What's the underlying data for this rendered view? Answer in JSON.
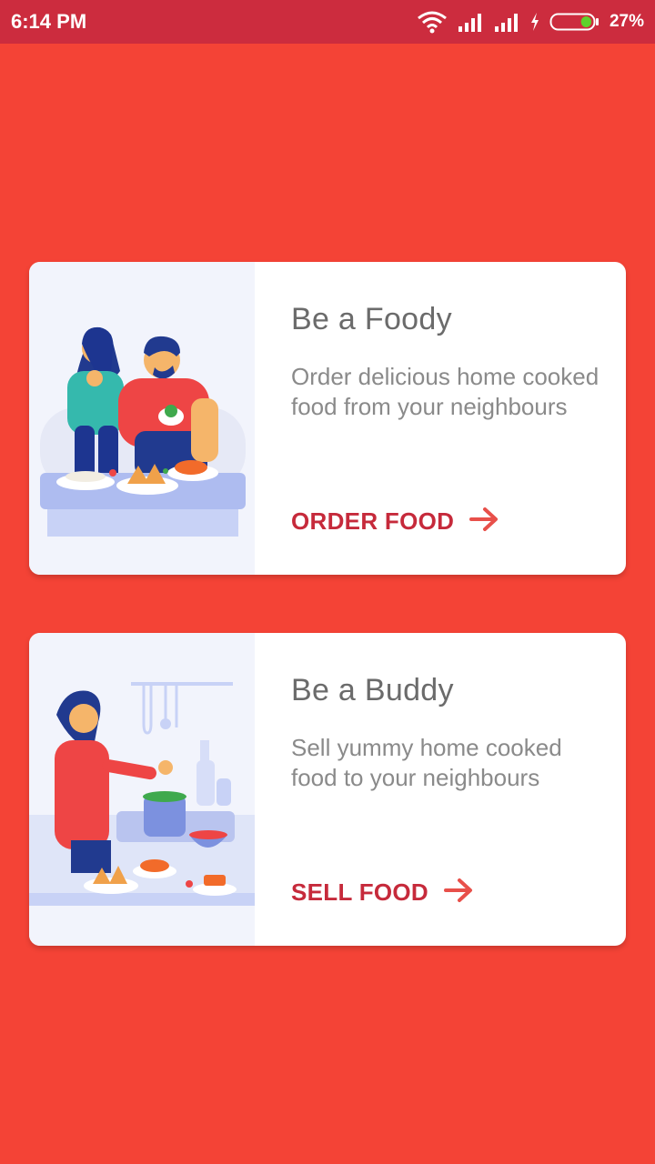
{
  "status_bar": {
    "time": "6:14 PM",
    "battery_percent": "27%",
    "battery_level": 0.27,
    "icons": [
      "wifi-icon",
      "signal-icon",
      "signal-icon",
      "charging-icon",
      "battery-icon"
    ]
  },
  "cards": [
    {
      "title": "Be a Foody",
      "description": "Order delicious home cooked food from your neighbours",
      "action_label": "ORDER FOOD",
      "action_icon": "arrow-right-icon",
      "illustration": "couple-eating-illustration"
    },
    {
      "title": "Be a Buddy",
      "description": "Sell yummy home cooked food to your neighbours",
      "action_label": "SELL FOOD",
      "action_icon": "arrow-right-icon",
      "illustration": "woman-cooking-illustration"
    }
  ],
  "colors": {
    "background": "#f44336",
    "status_bar": "#cc2c3e",
    "card": "#ffffff",
    "title_text": "#6b6b6b",
    "body_text": "#8a8a8a",
    "accent": "#c62a3b",
    "arrow": "#e8504a"
  }
}
